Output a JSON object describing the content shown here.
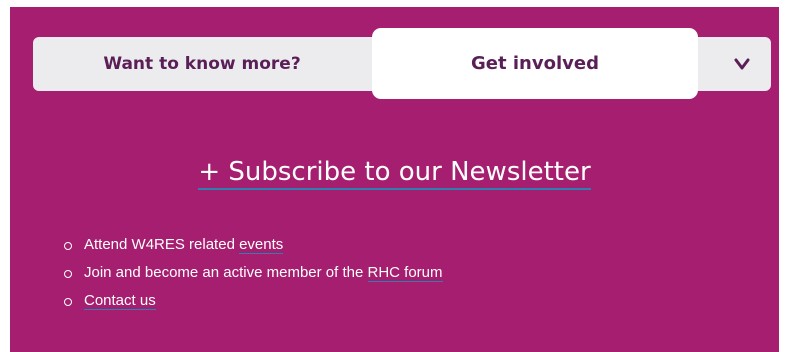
{
  "tabs": {
    "more_label": "Want to know more?",
    "involved_label": "Get involved",
    "toggle_icon": "chevron-down-icon"
  },
  "subscribe": {
    "label": "+ Subscribe to our Newsletter"
  },
  "list": {
    "item1_text": "Attend W4RES related ",
    "item1_link": "events",
    "item2_text": "Join and become an active member of the ",
    "item2_link": "RHC forum",
    "item3_link": "Contact us"
  },
  "colors": {
    "panel": "#a61e6f",
    "tabbar": "#ececee",
    "tab_text": "#5a1f57",
    "underline": "#2d7fb0"
  }
}
